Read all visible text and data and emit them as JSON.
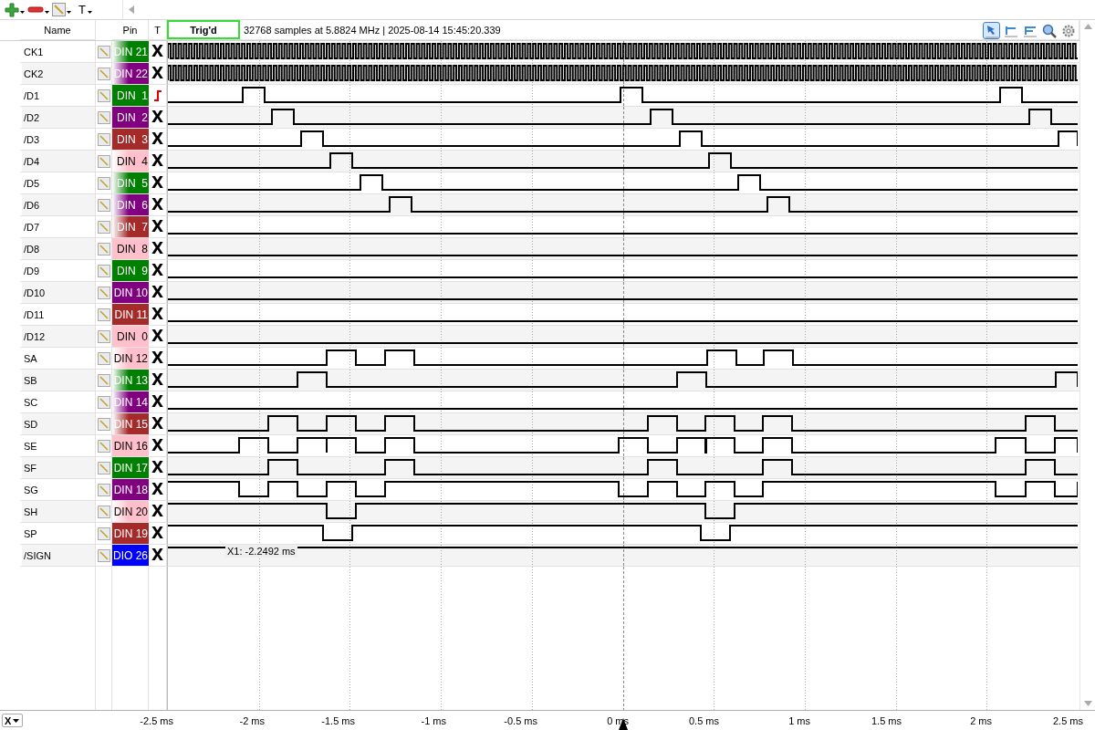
{
  "toolbar": {
    "text_tool": "T"
  },
  "columns": {
    "name": "Name",
    "pin": "Pin",
    "trigger": "T"
  },
  "status": {
    "label": "Trig'd",
    "info": "32768 samples at 5.8824 MHz | 2025-08-14 15:45:20.339"
  },
  "plot_tools": [
    {
      "kind": "pointer",
      "selected": true
    },
    {
      "kind": "cursor",
      "selected": false
    },
    {
      "kind": "cursor-pair",
      "selected": false
    },
    {
      "kind": "zoom",
      "selected": false
    },
    {
      "kind": "settings",
      "selected": false
    }
  ],
  "channels": [
    {
      "name": "CK1",
      "pin": "DIN 21",
      "color": "#008000",
      "fade": true,
      "trigger": {
        "kind": "none",
        "label": "X"
      }
    },
    {
      "name": "CK2",
      "pin": "DIN 22",
      "color": "#800080",
      "fade": true,
      "trigger": {
        "kind": "none",
        "label": "X"
      }
    },
    {
      "name": "/D1",
      "pin": "DIN  1",
      "color": "#008000",
      "fade": false,
      "trigger": {
        "kind": "rising"
      }
    },
    {
      "name": "/D2",
      "pin": "DIN  2",
      "color": "#800080",
      "fade": false,
      "trigger": {
        "kind": "none",
        "label": "X"
      }
    },
    {
      "name": "/D3",
      "pin": "DIN  3",
      "color": "#a52a2a",
      "fade": false,
      "trigger": {
        "kind": "none",
        "label": "X"
      }
    },
    {
      "name": "/D4",
      "pin": "DIN  4",
      "color": "#ffc0cb",
      "fade": true,
      "trigger": {
        "kind": "none",
        "label": "X"
      }
    },
    {
      "name": "/D5",
      "pin": "DIN  5",
      "color": "#008000",
      "fade": true,
      "trigger": {
        "kind": "none",
        "label": "X"
      }
    },
    {
      "name": "/D6",
      "pin": "DIN  6",
      "color": "#800080",
      "fade": true,
      "trigger": {
        "kind": "none",
        "label": "X"
      }
    },
    {
      "name": "/D7",
      "pin": "DIN  7",
      "color": "#a52a2a",
      "fade": true,
      "trigger": {
        "kind": "none",
        "label": "X"
      }
    },
    {
      "name": "/D8",
      "pin": "DIN  8",
      "color": "#ffc0cb",
      "fade": false,
      "trigger": {
        "kind": "none",
        "label": "X"
      }
    },
    {
      "name": "/D9",
      "pin": "DIN  9",
      "color": "#008000",
      "fade": false,
      "trigger": {
        "kind": "none",
        "label": "X"
      }
    },
    {
      "name": "/D10",
      "pin": "DIN 10",
      "color": "#800080",
      "fade": false,
      "trigger": {
        "kind": "none",
        "label": "X"
      }
    },
    {
      "name": "/D11",
      "pin": "DIN 11",
      "color": "#a52a2a",
      "fade": false,
      "trigger": {
        "kind": "none",
        "label": "X"
      }
    },
    {
      "name": "/D12",
      "pin": "DIN  0",
      "color": "#ffc0cb",
      "fade": false,
      "trigger": {
        "kind": "none",
        "label": "X"
      }
    },
    {
      "name": "SA",
      "pin": "DIN 12",
      "color": "#ffc0cb",
      "fade": true,
      "trigger": {
        "kind": "none",
        "label": "X"
      }
    },
    {
      "name": "SB",
      "pin": "DIN 13",
      "color": "#008000",
      "fade": true,
      "trigger": {
        "kind": "none",
        "label": "X"
      }
    },
    {
      "name": "SC",
      "pin": "DIN 14",
      "color": "#800080",
      "fade": true,
      "trigger": {
        "kind": "none",
        "label": "X"
      }
    },
    {
      "name": "SD",
      "pin": "DIN 15",
      "color": "#a52a2a",
      "fade": true,
      "trigger": {
        "kind": "none",
        "label": "X"
      }
    },
    {
      "name": "SE",
      "pin": "DIN 16",
      "color": "#ffc0cb",
      "fade": false,
      "trigger": {
        "kind": "none",
        "label": "X"
      }
    },
    {
      "name": "SF",
      "pin": "DIN 17",
      "color": "#008000",
      "fade": false,
      "trigger": {
        "kind": "none",
        "label": "X"
      }
    },
    {
      "name": "SG",
      "pin": "DIN 18",
      "color": "#800080",
      "fade": false,
      "trigger": {
        "kind": "none",
        "label": "X"
      }
    },
    {
      "name": "SH",
      "pin": "DIN 20",
      "color": "#ffc0cb",
      "fade": true,
      "trigger": {
        "kind": "none",
        "label": "X"
      }
    },
    {
      "name": "SP",
      "pin": "DIN 19",
      "color": "#a52a2a",
      "fade": false,
      "trigger": {
        "kind": "none",
        "label": "X"
      }
    },
    {
      "name": "/SIGN",
      "pin": "DIO 26",
      "color": "#0000ff",
      "fade": false,
      "trigger": {
        "kind": "none",
        "label": "X"
      }
    }
  ],
  "cursor": {
    "label": "X1: -2.2492 ms"
  },
  "axis": {
    "selector": "X",
    "ticks": [
      "-2.5 ms",
      "-2 ms",
      "-1.5 ms",
      "-1 ms",
      "-0.5 ms",
      "0 ms",
      "0.5 ms",
      "1 ms",
      "1.5 ms",
      "2 ms",
      "2.5 ms"
    ]
  }
}
